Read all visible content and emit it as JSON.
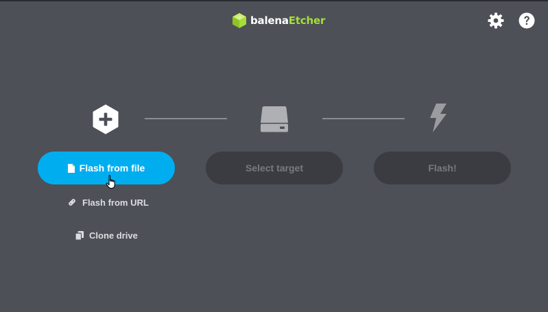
{
  "app": {
    "logo_text_primary": "balena",
    "logo_text_accent": "Etcher",
    "accent_color": "#a5de37",
    "background_color": "#4d5057"
  },
  "header": {
    "settings_icon": "gear-icon",
    "help_icon": "question-circle-icon"
  },
  "steps": {
    "source": {
      "icon": "plus-hexagon-icon",
      "primary_button": "Flash from file",
      "primary_button_icon": "file-icon",
      "primary_button_color": "#00aeef",
      "alternatives": [
        {
          "label": "Flash from URL",
          "icon": "link-icon"
        },
        {
          "label": "Clone drive",
          "icon": "copy-icon"
        }
      ]
    },
    "target": {
      "icon": "hard-drive-icon",
      "button": "Select target"
    },
    "flash": {
      "icon": "lightning-bolt-icon",
      "button": "Flash!"
    }
  }
}
